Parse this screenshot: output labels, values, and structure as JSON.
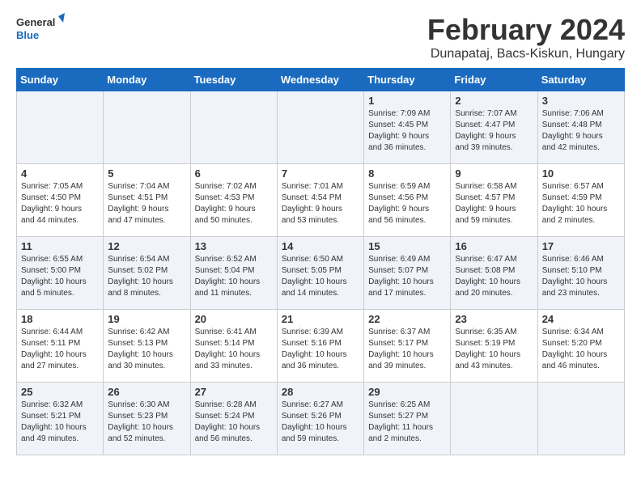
{
  "header": {
    "logo_general": "General",
    "logo_blue": "Blue",
    "month_title": "February 2024",
    "location": "Dunapataj, Bacs-Kiskun, Hungary"
  },
  "days_of_week": [
    "Sunday",
    "Monday",
    "Tuesday",
    "Wednesday",
    "Thursday",
    "Friday",
    "Saturday"
  ],
  "weeks": [
    [
      {
        "day": "",
        "info": ""
      },
      {
        "day": "",
        "info": ""
      },
      {
        "day": "",
        "info": ""
      },
      {
        "day": "",
        "info": ""
      },
      {
        "day": "1",
        "info": "Sunrise: 7:09 AM\nSunset: 4:45 PM\nDaylight: 9 hours\nand 36 minutes."
      },
      {
        "day": "2",
        "info": "Sunrise: 7:07 AM\nSunset: 4:47 PM\nDaylight: 9 hours\nand 39 minutes."
      },
      {
        "day": "3",
        "info": "Sunrise: 7:06 AM\nSunset: 4:48 PM\nDaylight: 9 hours\nand 42 minutes."
      }
    ],
    [
      {
        "day": "4",
        "info": "Sunrise: 7:05 AM\nSunset: 4:50 PM\nDaylight: 9 hours\nand 44 minutes."
      },
      {
        "day": "5",
        "info": "Sunrise: 7:04 AM\nSunset: 4:51 PM\nDaylight: 9 hours\nand 47 minutes."
      },
      {
        "day": "6",
        "info": "Sunrise: 7:02 AM\nSunset: 4:53 PM\nDaylight: 9 hours\nand 50 minutes."
      },
      {
        "day": "7",
        "info": "Sunrise: 7:01 AM\nSunset: 4:54 PM\nDaylight: 9 hours\nand 53 minutes."
      },
      {
        "day": "8",
        "info": "Sunrise: 6:59 AM\nSunset: 4:56 PM\nDaylight: 9 hours\nand 56 minutes."
      },
      {
        "day": "9",
        "info": "Sunrise: 6:58 AM\nSunset: 4:57 PM\nDaylight: 9 hours\nand 59 minutes."
      },
      {
        "day": "10",
        "info": "Sunrise: 6:57 AM\nSunset: 4:59 PM\nDaylight: 10 hours\nand 2 minutes."
      }
    ],
    [
      {
        "day": "11",
        "info": "Sunrise: 6:55 AM\nSunset: 5:00 PM\nDaylight: 10 hours\nand 5 minutes."
      },
      {
        "day": "12",
        "info": "Sunrise: 6:54 AM\nSunset: 5:02 PM\nDaylight: 10 hours\nand 8 minutes."
      },
      {
        "day": "13",
        "info": "Sunrise: 6:52 AM\nSunset: 5:04 PM\nDaylight: 10 hours\nand 11 minutes."
      },
      {
        "day": "14",
        "info": "Sunrise: 6:50 AM\nSunset: 5:05 PM\nDaylight: 10 hours\nand 14 minutes."
      },
      {
        "day": "15",
        "info": "Sunrise: 6:49 AM\nSunset: 5:07 PM\nDaylight: 10 hours\nand 17 minutes."
      },
      {
        "day": "16",
        "info": "Sunrise: 6:47 AM\nSunset: 5:08 PM\nDaylight: 10 hours\nand 20 minutes."
      },
      {
        "day": "17",
        "info": "Sunrise: 6:46 AM\nSunset: 5:10 PM\nDaylight: 10 hours\nand 23 minutes."
      }
    ],
    [
      {
        "day": "18",
        "info": "Sunrise: 6:44 AM\nSunset: 5:11 PM\nDaylight: 10 hours\nand 27 minutes."
      },
      {
        "day": "19",
        "info": "Sunrise: 6:42 AM\nSunset: 5:13 PM\nDaylight: 10 hours\nand 30 minutes."
      },
      {
        "day": "20",
        "info": "Sunrise: 6:41 AM\nSunset: 5:14 PM\nDaylight: 10 hours\nand 33 minutes."
      },
      {
        "day": "21",
        "info": "Sunrise: 6:39 AM\nSunset: 5:16 PM\nDaylight: 10 hours\nand 36 minutes."
      },
      {
        "day": "22",
        "info": "Sunrise: 6:37 AM\nSunset: 5:17 PM\nDaylight: 10 hours\nand 39 minutes."
      },
      {
        "day": "23",
        "info": "Sunrise: 6:35 AM\nSunset: 5:19 PM\nDaylight: 10 hours\nand 43 minutes."
      },
      {
        "day": "24",
        "info": "Sunrise: 6:34 AM\nSunset: 5:20 PM\nDaylight: 10 hours\nand 46 minutes."
      }
    ],
    [
      {
        "day": "25",
        "info": "Sunrise: 6:32 AM\nSunset: 5:21 PM\nDaylight: 10 hours\nand 49 minutes."
      },
      {
        "day": "26",
        "info": "Sunrise: 6:30 AM\nSunset: 5:23 PM\nDaylight: 10 hours\nand 52 minutes."
      },
      {
        "day": "27",
        "info": "Sunrise: 6:28 AM\nSunset: 5:24 PM\nDaylight: 10 hours\nand 56 minutes."
      },
      {
        "day": "28",
        "info": "Sunrise: 6:27 AM\nSunset: 5:26 PM\nDaylight: 10 hours\nand 59 minutes."
      },
      {
        "day": "29",
        "info": "Sunrise: 6:25 AM\nSunset: 5:27 PM\nDaylight: 11 hours\nand 2 minutes."
      },
      {
        "day": "",
        "info": ""
      },
      {
        "day": "",
        "info": ""
      }
    ]
  ]
}
